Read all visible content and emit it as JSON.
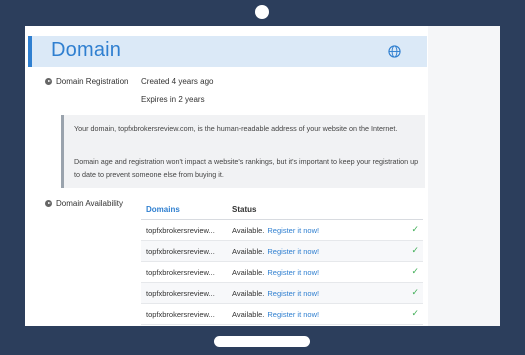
{
  "header": {
    "title": "Domain"
  },
  "registration": {
    "label": "Domain Registration",
    "created": "Created 4 years ago",
    "expires": "Expires in 2 years"
  },
  "notice": {
    "para1": "Your domain, topfxbrokersreview.com, is the human-readable address of your website on the Internet.",
    "para2": "Domain age and registration won't impact a website's rankings, but it's important to keep your registration up to date to prevent someone else from buying it."
  },
  "availability": {
    "label": "Domain Availability",
    "columns": {
      "domains": "Domains",
      "status": "Status"
    },
    "rows": [
      {
        "domain": "topfxbrokersreview...",
        "status": "Available.",
        "action": "Register it now!"
      },
      {
        "domain": "topfxbrokersreview...",
        "status": "Available.",
        "action": "Register it now!"
      },
      {
        "domain": "topfxbrokersreview...",
        "status": "Available.",
        "action": "Register it now!"
      },
      {
        "domain": "topfxbrokersreview...",
        "status": "Available.",
        "action": "Register it now!"
      },
      {
        "domain": "topfxbrokersreview...",
        "status": "Available.",
        "action": "Register it now!"
      }
    ]
  },
  "icons": {
    "globe": "globe-icon",
    "check": "check-icon",
    "bullet": "play-dot-icon"
  },
  "colors": {
    "accent": "#2f7fd0",
    "header_bg": "#dbe9f7",
    "frame": "#2c3e5c",
    "success": "#3fae56"
  }
}
